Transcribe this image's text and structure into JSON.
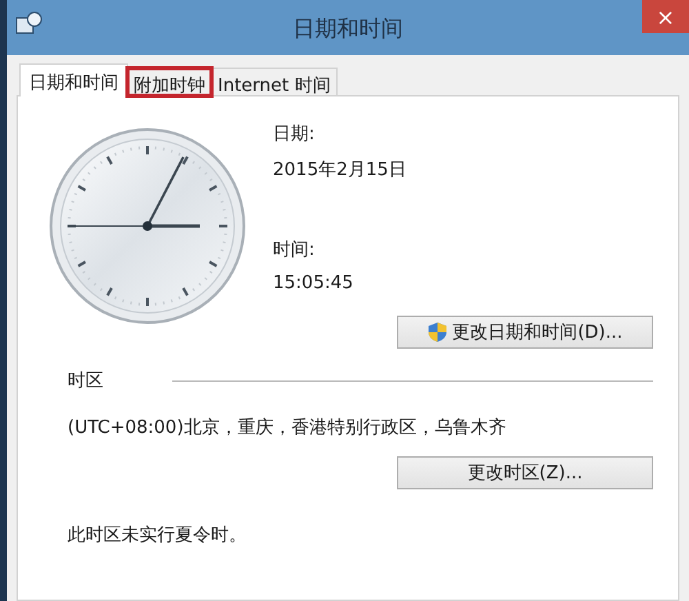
{
  "window": {
    "title": "日期和时间",
    "close": "×"
  },
  "tabs": [
    {
      "label": "日期和时间",
      "selected": true,
      "highlighted": false
    },
    {
      "label": "附加时钟",
      "selected": false,
      "highlighted": true
    },
    {
      "label": "Internet 时间",
      "selected": false,
      "highlighted": false
    }
  ],
  "date": {
    "label": "日期:",
    "value": "2015年2月15日"
  },
  "time": {
    "label": "时间:",
    "value": "15:05:45"
  },
  "change_datetime_button": "更改日期和时间(D)...",
  "timezone": {
    "heading": "时区",
    "value": "(UTC+08:00)北京，重庆，香港特别行政区，乌鲁木齐",
    "button": "更改时区(Z)...",
    "dst_note": "此时区未实行夏令时。"
  }
}
